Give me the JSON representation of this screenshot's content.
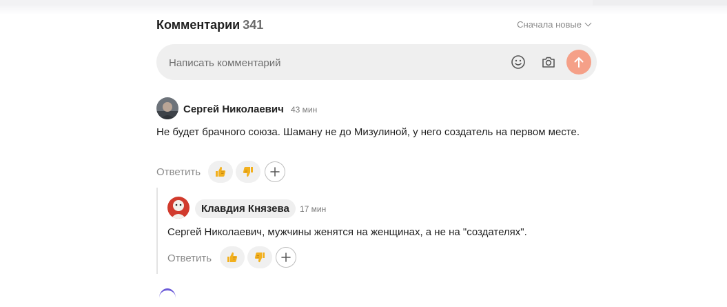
{
  "comments_section": {
    "title": "Комментарии",
    "count": "341",
    "sort_label": "Сначала новые"
  },
  "composer": {
    "placeholder": "Написать комментарий",
    "emoji_icon": "smile-icon",
    "photo_icon": "camera-icon",
    "send_icon": "arrow-up-icon",
    "send_color": "#f5a088"
  },
  "comments": [
    {
      "author": "Сергей Николаевич",
      "time": "43 мин",
      "text": "Не будет брачного союза. Шаману не до Мизулиной, у него создатель на первом месте.",
      "reply_label": "Ответить",
      "like_icon": "thumbs-up-icon",
      "dislike_icon": "thumbs-down-icon",
      "add_reaction_icon": "plus-icon"
    },
    {
      "author": "Клавдия Князева",
      "time": "17 мин",
      "text": "Сергей Николаевич, мужчины женятся на женщинах, а не на \"создателях\".",
      "reply_label": "Ответить",
      "like_icon": "thumbs-up-icon",
      "dislike_icon": "thumbs-down-icon",
      "add_reaction_icon": "plus-icon"
    }
  ]
}
